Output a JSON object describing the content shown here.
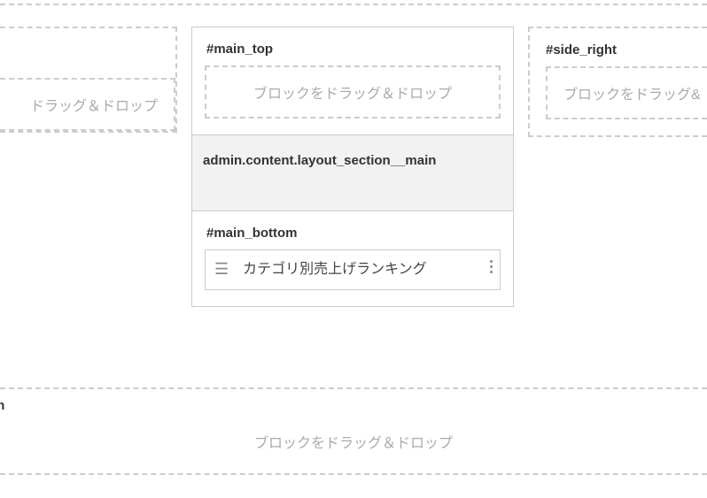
{
  "placeholder_text": "ブロックをドラッグ＆ドロップ",
  "side_left": {
    "drop_text": "ドラッグ＆ドロップ"
  },
  "main_top": {
    "label": "#main_top",
    "drop_text": "ブロックをドラッグ＆ドロップ"
  },
  "main": {
    "label": "admin.content.layout_section__main"
  },
  "main_bottom": {
    "label": "#main_bottom",
    "blocks": [
      {
        "title": "カテゴリ別売上げランキング"
      }
    ]
  },
  "side_right": {
    "label": "#side_right",
    "drop_text": "ブロックをドラッグ&"
  },
  "bottom": {
    "label_suffix": "m",
    "drop_text": "ブロックをドラッグ＆ドロップ"
  }
}
